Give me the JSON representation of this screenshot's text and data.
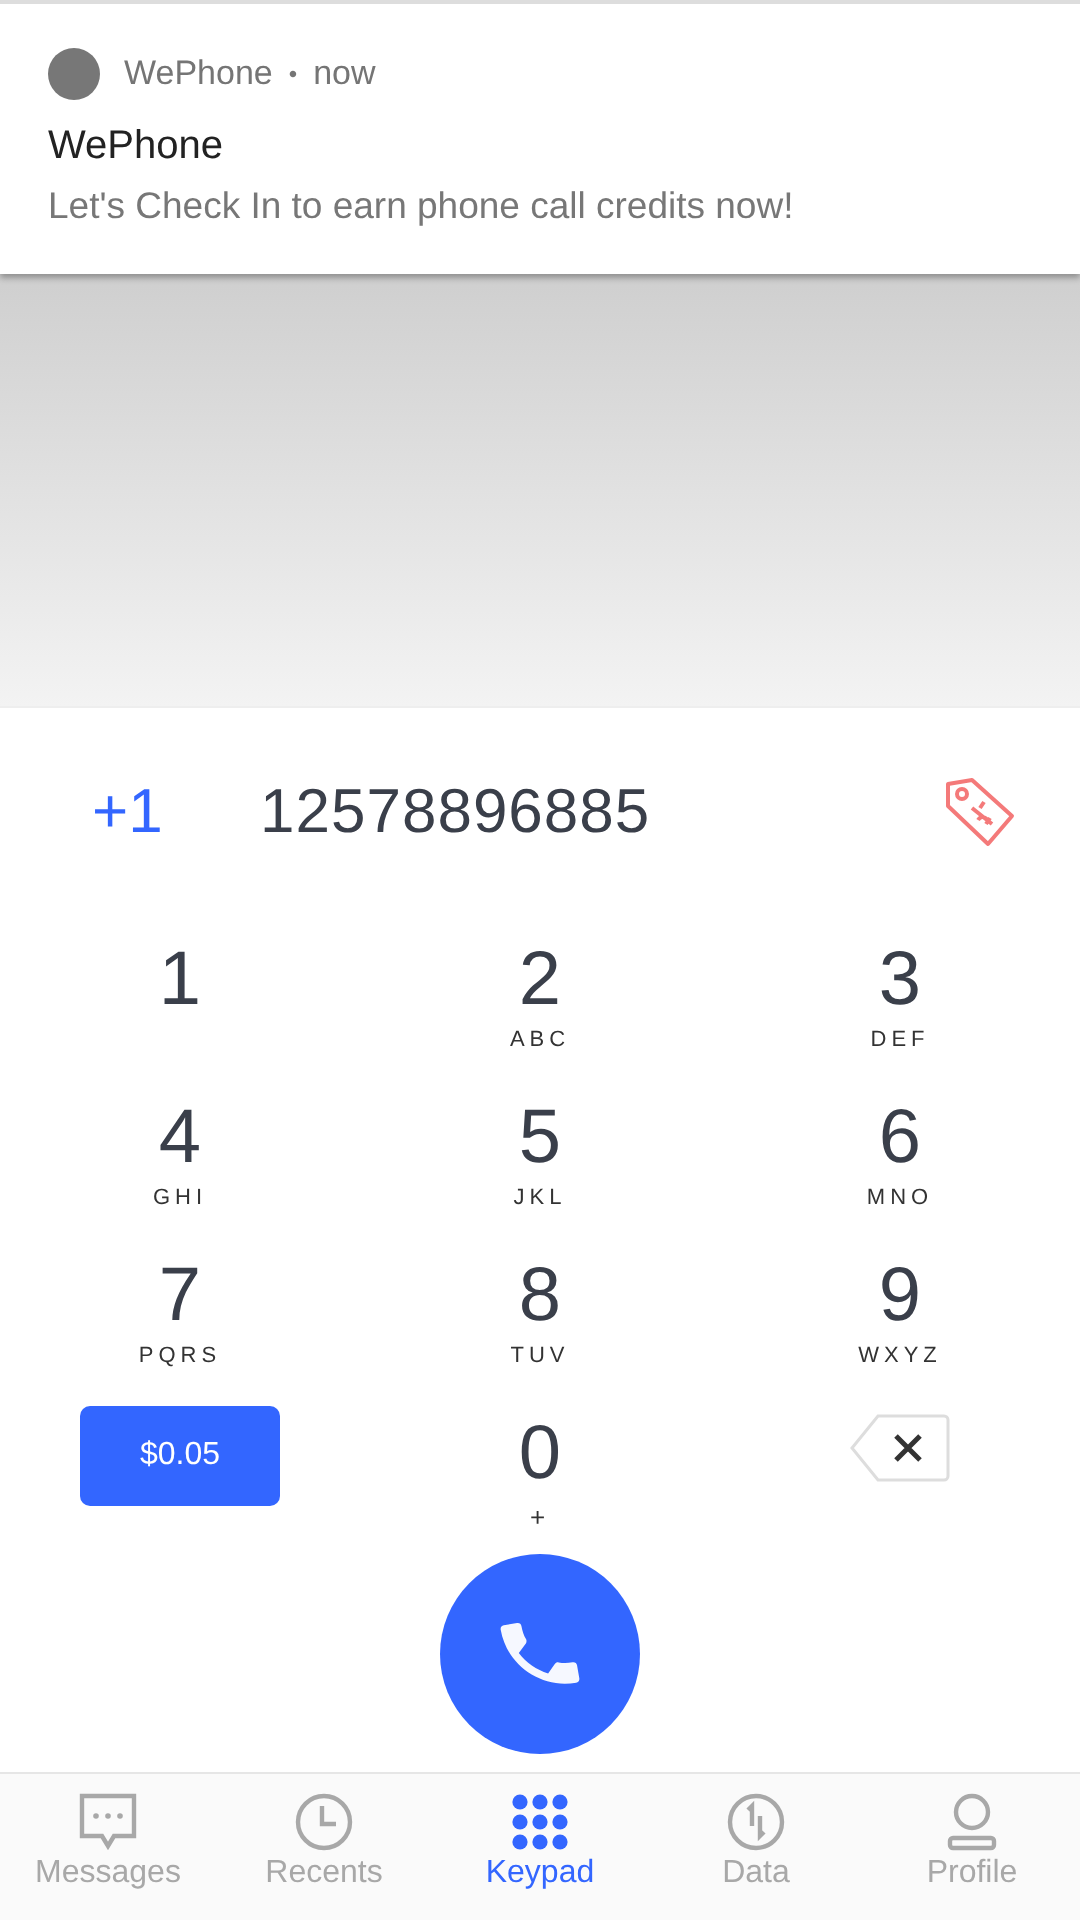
{
  "notification": {
    "app": "WePhone",
    "separator": "•",
    "time": "now",
    "title": "WePhone",
    "body": "Let's Check In to earn phone call credits now!"
  },
  "dialer": {
    "country_code": "+1",
    "number": "12578896885"
  },
  "keys": [
    {
      "digit": "1"
    },
    {
      "digit": "2",
      "letters": "ABC"
    },
    {
      "digit": "3",
      "letters": "DEF"
    },
    {
      "digit": "4",
      "letters": "GHI"
    },
    {
      "digit": "5",
      "letters": "JKL"
    },
    {
      "digit": "6",
      "letters": "MNO"
    },
    {
      "digit": "7",
      "letters": "PQRS"
    },
    {
      "digit": "8",
      "letters": "TUV"
    },
    {
      "digit": "9",
      "letters": "WXYZ"
    }
  ],
  "rate_button": "$0.05",
  "zero_key": {
    "digit": "0",
    "letters": "+"
  },
  "tabs": [
    {
      "label": "Messages",
      "kind": "messages",
      "selected": false
    },
    {
      "label": "Recents",
      "kind": "recents",
      "selected": false
    },
    {
      "label": "Keypad",
      "kind": "keypad",
      "selected": true
    },
    {
      "label": "Data",
      "kind": "data",
      "selected": false
    },
    {
      "label": "Profile",
      "kind": "profile",
      "selected": false
    }
  ]
}
